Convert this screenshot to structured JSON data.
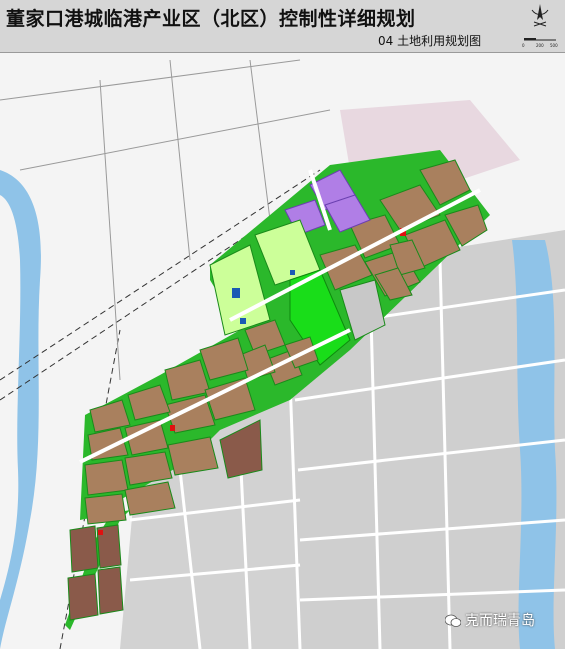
{
  "header": {
    "title": "董家口港城临港产业区（北区）控制性详细规划",
    "subtitle": "04 土地利用规划图"
  },
  "compass": {
    "scale_zero": "0",
    "scale_mid": "200",
    "scale_end": "500"
  },
  "colors": {
    "residential": "#a9805e",
    "green": "#19cc19",
    "light_green": "#ccff99",
    "purple": "#b07ee6",
    "gray_block": "#c8c8c8",
    "water": "#8fc3e8",
    "road": "#ffffff"
  },
  "watermark": {
    "text": "克而瑞青岛",
    "icon": "wechat-icon"
  }
}
